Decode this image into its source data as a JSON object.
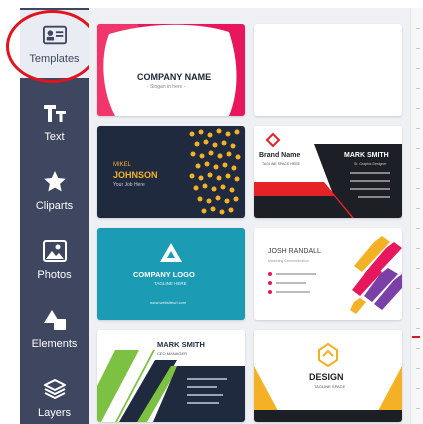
{
  "sidebar": {
    "items": [
      {
        "label": "Templates",
        "icon": "id-card-icon"
      },
      {
        "label": "Text",
        "icon": "text-tt-icon"
      },
      {
        "label": "Cliparts",
        "icon": "star-icon"
      },
      {
        "label": "Photos",
        "icon": "image-icon"
      },
      {
        "label": "Elements",
        "icon": "shapes-icon"
      },
      {
        "label": "Layers",
        "icon": "layers-icon"
      }
    ]
  },
  "cards": {
    "c1": {
      "title": "COMPANY NAME",
      "tagline": "- Slogan in here -"
    },
    "c3": {
      "first": "MIKEL",
      "last": "JOHNSON",
      "job": "Your Job Here"
    },
    "c4": {
      "brand": "Brand Name",
      "brand_tag": "TAGLINE SPACE HERE",
      "name": "MARK SMITH",
      "role": "Sr. Graphic Designer"
    },
    "c5": {
      "title": "COMPANY LOGO",
      "tagline": "TAGLINE HERE",
      "web": "www.websiteurl.com"
    },
    "c6": {
      "name": "JOSH RANDALL",
      "role": "Marketing Communication"
    },
    "c7": {
      "name": "MARK SMITH",
      "role": "CEO MANAGER"
    },
    "c8": {
      "title": "DESIGN",
      "tagline": "TAGLINE SPACE"
    }
  },
  "colors": {
    "sidebar": "#3f4760",
    "active": "#e9ecf2",
    "highlight": "#e0141e",
    "navy": "#1f2a3f",
    "teal": "#1b9bb4",
    "orange": "#f4b126",
    "green": "#7dc142",
    "purple": "#7b3fa8"
  }
}
